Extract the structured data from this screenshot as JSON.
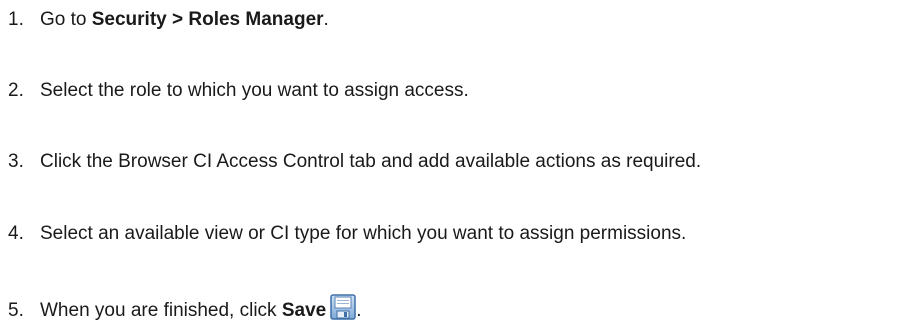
{
  "steps": [
    {
      "number": "1.",
      "pre": "Go to ",
      "bold": "Security > Roles Manager",
      "post": "."
    },
    {
      "number": "2.",
      "text": "Select the role to which you want to assign access."
    },
    {
      "number": "3.",
      "text": "Click the Browser CI Access Control tab and add available actions as required."
    },
    {
      "number": "4.",
      "text": "Select an available view or CI type for which you want to assign permissions."
    },
    {
      "number": "5.",
      "pre": "When you are finished, click ",
      "bold": "Save",
      "post": ".",
      "icon": "save-icon"
    }
  ]
}
